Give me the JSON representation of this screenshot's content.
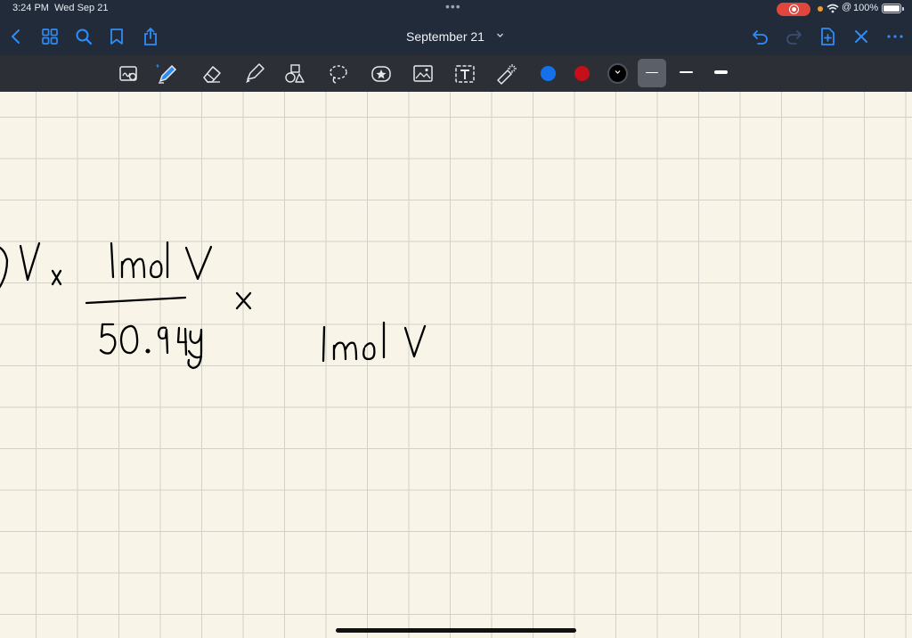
{
  "status_bar": {
    "time": "3:24 PM",
    "date": "Wed Sep 21",
    "battery": "100%"
  },
  "document": {
    "title": "September 21"
  },
  "colors": {
    "ink_blue": "#1670ec",
    "ink_red": "#c5101a",
    "ink_black": "#000000",
    "paper": "#f8f5e8",
    "toolbar": "#2c2f35",
    "header": "#222b3a",
    "accent": "#2f8cf5"
  },
  "icons": {
    "nav_left": [
      "back-chevron-icon",
      "thumbnails-grid-icon",
      "search-icon",
      "bookmark-icon",
      "share-icon"
    ],
    "nav_right": [
      "undo-icon",
      "redo-icon",
      "add-page-icon",
      "close-icon",
      "more-icon"
    ],
    "tools": [
      "zoom-window-icon",
      "pen-icon",
      "eraser-icon",
      "highlighter-icon",
      "shapes-icon",
      "lasso-icon",
      "sticker-icon",
      "image-icon",
      "text-icon",
      "laser-pointer-icon"
    ]
  },
  "selected_color": "black",
  "selected_stroke": "fine"
}
